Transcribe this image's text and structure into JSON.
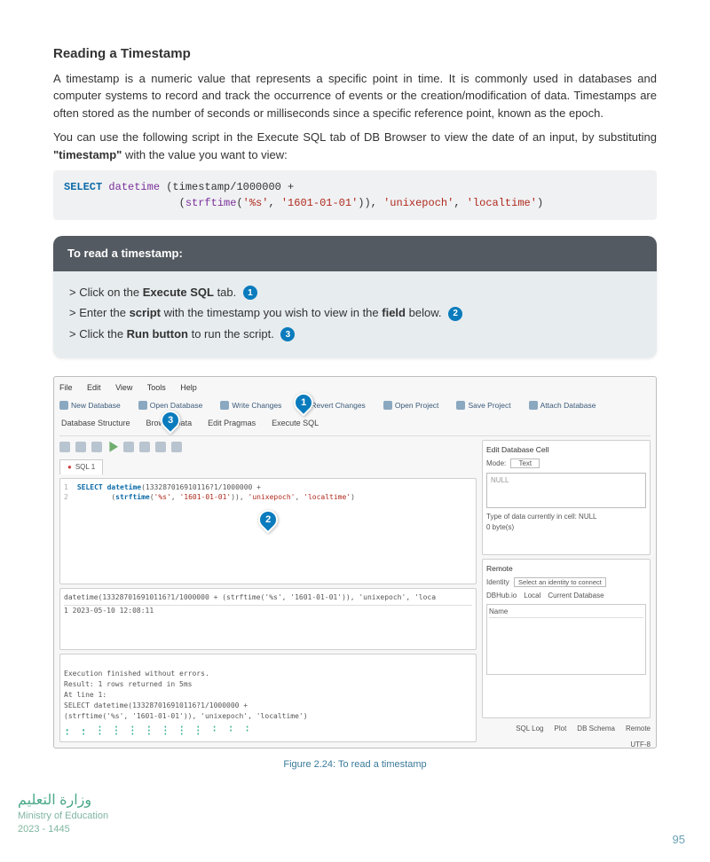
{
  "title": "Reading a Timestamp",
  "para1": "A timestamp is a numeric value that represents a specific point in time. It is commonly used in databases and computer systems to record and track the occurrence of events or the creation/modification of data. Timestamps are often stored as the number of seconds or milliseconds since a specific reference point, known as the epoch.",
  "para2_pre": "You can use the following script in the Execute SQL tab of DB Browser to view the date of an input, by substituting ",
  "para2_bold": "\"timestamp\"",
  "para2_post": " with the value you want to view:",
  "code": {
    "select": "SELECT",
    "dt": " datetime",
    "seg1": " (timestamp/1000000 +",
    "pad": "                  (",
    "strf": "strftime",
    "args1": "(",
    "s1": "'%s'",
    "c1": ", ",
    "s2": "'1601-01-01'",
    "args2": ")), ",
    "s3": "'unixepoch'",
    "c2": ", ",
    "s4": "'localtime'",
    "end": ")"
  },
  "steps": {
    "header": "To read a timestamp:",
    "l1_a": "> Click on the ",
    "l1_b": "Execute SQL",
    "l1_c": " tab. ",
    "l2_a": "> Enter the ",
    "l2_b": "script",
    "l2_c": " with the timestamp you wish to view in the ",
    "l2_d": "field",
    "l2_e": " below. ",
    "l3_a": "> Click the ",
    "l3_b": "Run button",
    "l3_c": " to run the script. ",
    "n1": "1",
    "n2": "2",
    "n3": "3"
  },
  "shot": {
    "menu": {
      "file": "File",
      "edit": "Edit",
      "view": "View",
      "tools": "Tools",
      "help": "Help"
    },
    "tb": {
      "new": "New Database",
      "open": "Open Database",
      "write": "Write Changes",
      "revert": "Revert Changes",
      "openp": "Open Project",
      "save": "Save Project",
      "attach": "Attach Database"
    },
    "tabs": {
      "struct": "Database Structure",
      "browse": "Browse Data",
      "pragma": "Edit Pragmas",
      "exec": "Execute SQL"
    },
    "sqltab": "SQL 1",
    "sql_l1": "SELECT datetime(133287016910116?1/1000000 +",
    "sql_l2": "        (strftime('%s', '1601-01-01')), 'unixepoch', 'localtime')",
    "result_h": "datetime(133287016910116?1/1000000 + (strftime('%s', '1601-01-01')), 'unixepoch', 'loca",
    "result_row": "1  2023-05-10 12:08:11",
    "log": "Execution finished without errors.\nResult: 1 rows returned in 5ms\nAt line 1:\nSELECT datetime(133287016910116?1/1000000 +\n        (strftime('%s', '1601-01-01')), 'unixepoch', 'localtime')",
    "editcell_title": "Edit Database Cell",
    "mode": "Mode:",
    "mode_val": "Text",
    "null": "NULL",
    "type_line": "Type of data currently in cell: NULL",
    "bytes": "0 byte(s)",
    "remote": "Remote",
    "identity": "Identity",
    "identity_sel": "Select an identity to connect",
    "rtabs": {
      "dbhub": "DBHub.io",
      "local": "Local",
      "cur": "Current Database"
    },
    "name_col": "Name",
    "status": {
      "sqllog": "SQL Log",
      "plot": "Plot",
      "dbschema": "DB Schema",
      "remote": "Remote",
      "utf": "UTF-8"
    }
  },
  "callouts": {
    "c1": "1",
    "c2": "2",
    "c3": "3"
  },
  "caption": "Figure 2.24: To read a timestamp",
  "footer": {
    "arabic": "وزارة التعليم",
    "en": "Ministry of Education",
    "yr": "2023 - 1445"
  },
  "page": "95"
}
